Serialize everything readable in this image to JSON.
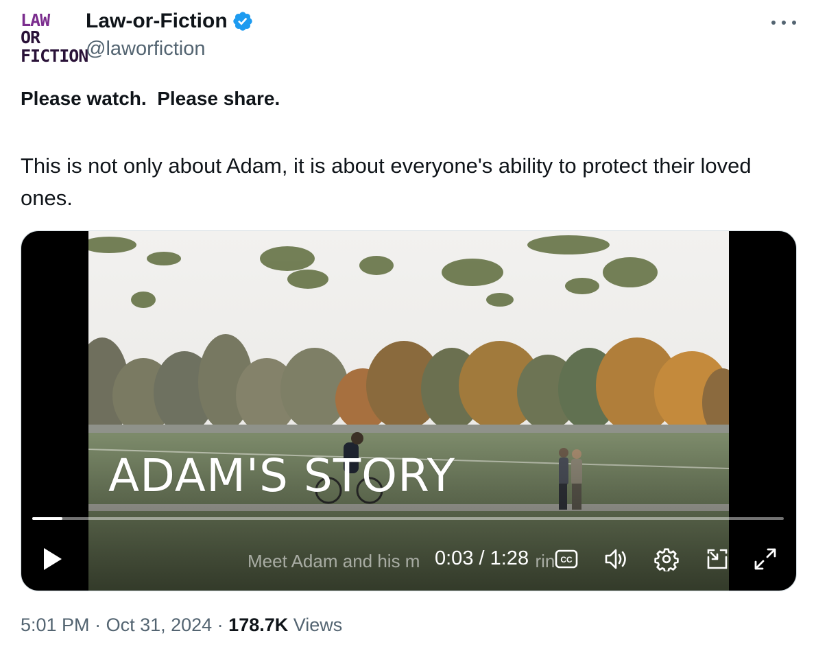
{
  "author": {
    "avatar_line1_a": "LAW",
    "avatar_line1_b": "OR",
    "avatar_line2": "FICTION",
    "display_name": "Law-or-Fiction",
    "handle": "@laworfiction",
    "verified_icon": "verified-badge-icon",
    "verified_color": "#1d9bf0"
  },
  "tweet": {
    "line1": "Please watch.  Please share.",
    "body": "This is not only about Adam, it is about everyone's ability to protect their loved ones."
  },
  "video": {
    "title_overlay": "ADAM'S STORY",
    "caption_text": "Meet Adam and his m",
    "caption_tail": "rin",
    "current_time": "0:03",
    "time_separator": " / ",
    "duration": "1:28",
    "progress_fraction": 0.04,
    "icons": [
      "play-icon",
      "closed-captions-icon",
      "volume-icon",
      "settings-gear-icon",
      "picture-in-picture-icon",
      "fullscreen-icon"
    ]
  },
  "meta": {
    "time": "5:01 PM",
    "separator": " · ",
    "date": "Oct 31, 2024",
    "views_count": "178.7K",
    "views_label": " Views"
  },
  "colors": {
    "text_primary": "#0f1419",
    "text_secondary": "#536471",
    "brand_purple": "#7b2d8e"
  }
}
